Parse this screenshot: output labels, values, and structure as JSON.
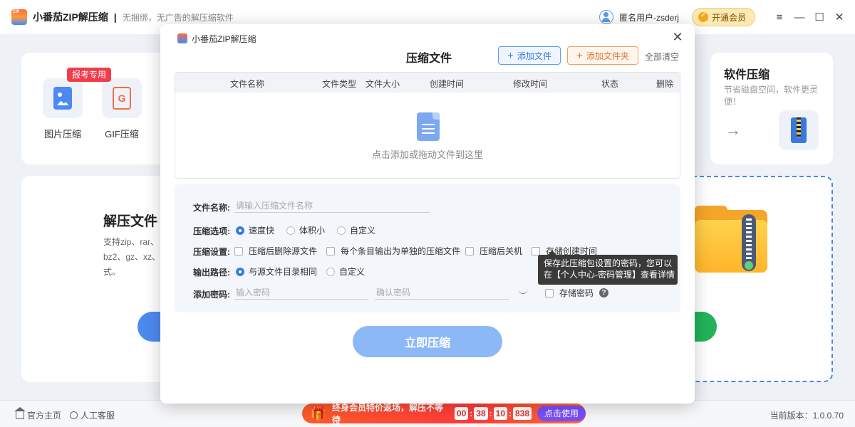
{
  "app": {
    "title": "小番茄ZIP解压缩",
    "separator": "|",
    "slogan": "无捆绑，无广告的解压缩软件"
  },
  "header": {
    "user_name": "匿名用户-zsderj",
    "vip_label": "开通会员",
    "menu_icon": "≡",
    "minimize_icon": "—",
    "maximize_icon": "☐",
    "close_icon": "✕"
  },
  "tools": {
    "exam_tag": "报考专用",
    "image_label": "图片压缩",
    "gif_label": "GIF压缩",
    "gif_glyph": "G"
  },
  "software_card": {
    "title": "软件压缩",
    "desc": "节省磁盘空间，软件更灵便！",
    "arrow": "→"
  },
  "decompress_card": {
    "title": "解压文件",
    "desc": "支持zip、rar、bz2、gz、xz、式。"
  },
  "modal": {
    "app_title": "小番茄ZIP解压缩",
    "close_icon": "✕",
    "heading": "压缩文件",
    "add_file_label": "添加文件",
    "add_folder_label": "添加文件夹",
    "clear_all_label": "全部清空",
    "plus": "+",
    "table_columns": [
      "文件名称",
      "文件类型",
      "文件大小",
      "创建时间",
      "修改时间",
      "状态",
      "删除"
    ],
    "empty_text": "点击添加或拖动文件到这里",
    "settings": {
      "name_label": "文件名称:",
      "name_placeholder": "请输入压缩文件名称",
      "option_label": "压缩选项:",
      "options": [
        "速度快",
        "体积小",
        "自定义"
      ],
      "option_selected": "速度快",
      "setting_label": "压缩设置:",
      "checkboxes": [
        "压缩后删除源文件",
        "每个条目输出为单独的压缩文件",
        "压缩后关机",
        "存储创建时间"
      ],
      "path_label": "输出路径:",
      "paths": [
        "与源文件目录相同",
        "自定义"
      ],
      "path_selected": "与源文件目录相同",
      "password_label": "添加密码:",
      "password_placeholder": "输入密码",
      "confirm_placeholder": "确认密码",
      "store_password_label": "存储密码",
      "help_glyph": "?"
    },
    "tooltip_line1": "保存此压缩包设置的密码，您可以",
    "tooltip_line2": "在【个人中心-密码管理】查看详情",
    "compress_button": "立即压缩"
  },
  "footer": {
    "home_label": "官方主页",
    "service_label": "人工客服",
    "version_label": "当前版本：1.0.0.70",
    "promo_text": "终身会员特价返场，解压不等待",
    "countdown": [
      "00",
      "38",
      "10",
      "838"
    ],
    "countdown_sep": ":",
    "promo_button": "点击使用",
    "gift_glyph": "🎁"
  },
  "colors": {
    "primary": "#3a7bdc",
    "compress_button": "#8db8f8",
    "promo_red": "#ff3b3b",
    "promo_button": "#7c4dfa",
    "exam_tag": "#f23c4b",
    "vip_bg": "#fde9b3"
  }
}
